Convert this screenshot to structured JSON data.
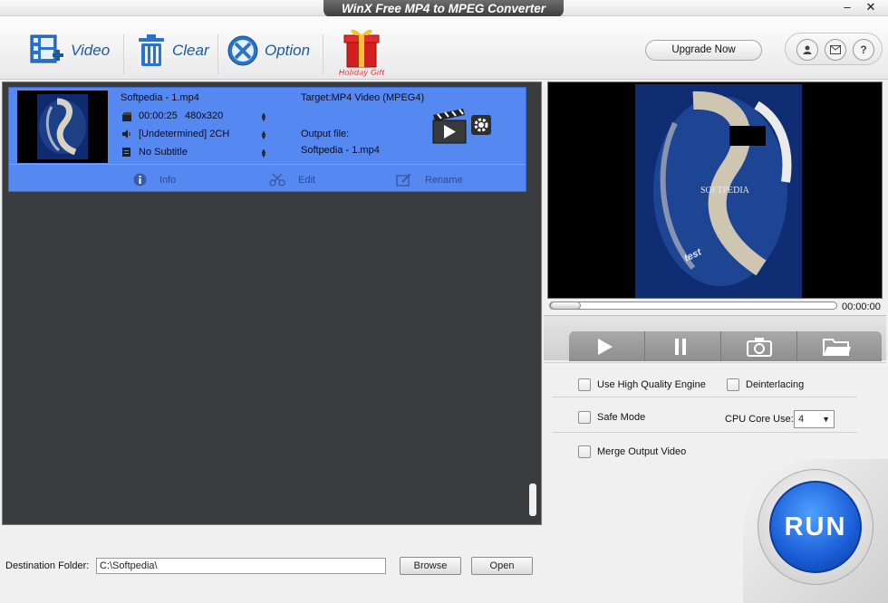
{
  "window": {
    "title": "WinX Free MP4 to MPEG Converter",
    "minimize": "–",
    "close": "✕"
  },
  "toolbar": {
    "video_label": "Video",
    "clear_label": "Clear",
    "option_label": "Option",
    "gift_label": "Holiday Gift",
    "upgrade_label": "Upgrade Now",
    "user_icon": "user-icon",
    "mail_icon": "mail-icon",
    "help_icon": "?"
  },
  "file": {
    "name": "Softpedia - 1.mp4",
    "duration": "00:00:25",
    "resolution": "480x320",
    "audio": "[Undetermined] 2CH",
    "subtitle": "No Subtitle",
    "target": "Target:MP4 Video (MPEG4)",
    "output_label": "Output file:",
    "output_name": "Softpedia - 1.mp4",
    "actions": {
      "info": "Info",
      "edit": "Edit",
      "rename": "Rename"
    }
  },
  "player": {
    "time": "00:00:00",
    "watermark": "SOFTPEDIA",
    "caption": "test"
  },
  "options": {
    "high_quality": "Use High Quality Engine",
    "deinterlacing": "Deinterlacing",
    "safe_mode": "Safe Mode",
    "cpu_label": "CPU Core Use:",
    "cpu_value": "4",
    "merge": "Merge Output Video"
  },
  "run_label": "RUN",
  "destination": {
    "label": "Destination Folder:",
    "path": "C:\\Softpedia\\",
    "browse": "Browse",
    "open": "Open"
  },
  "colors": {
    "accent": "#1c5a9a",
    "file_row": "#5588f0",
    "panel": "#3b3c40",
    "run": "#1a5cd6"
  }
}
